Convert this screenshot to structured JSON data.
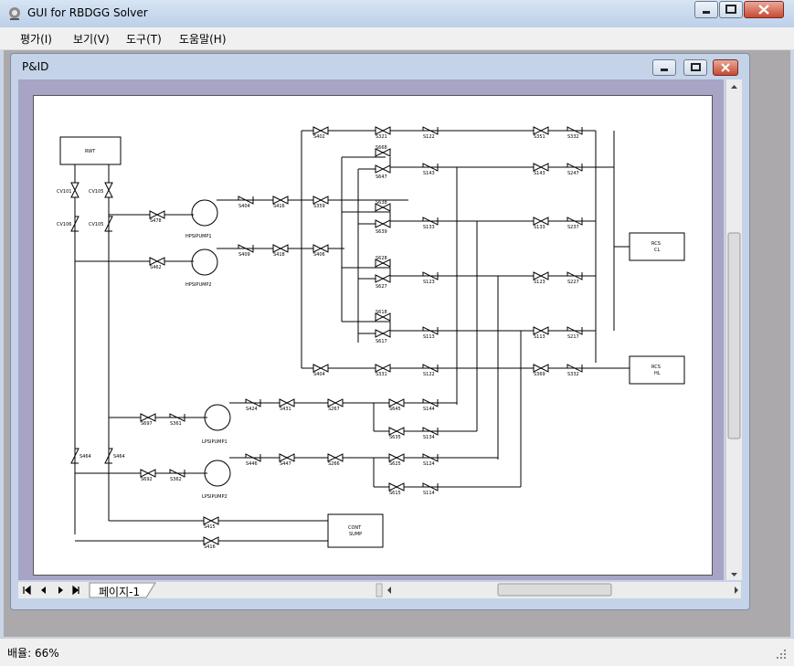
{
  "app": {
    "title": "GUI for RBDGG Solver"
  },
  "menu": {
    "items": [
      "평가(I)",
      "보기(V)",
      "도구(T)",
      "도움말(H)"
    ]
  },
  "child_window": {
    "title": "P&ID"
  },
  "tabs": {
    "page_tab": "페이지-1"
  },
  "status": {
    "zoom": "배율: 66%"
  },
  "diagram": {
    "boxes": {
      "rwt": "RWT",
      "rcs_cl": "RCS",
      "rcs_cl2": "CL",
      "rcs_hl": "RCS",
      "rcs_hl2": "HL",
      "sump": "CONT",
      "sump2": "SUMP"
    },
    "pumps": {
      "hp1": "HPSIPUMP1",
      "hp2": "HPSIPUMP2",
      "lp1": "LPSIPUMP1",
      "lp2": "LPSIPUMP2"
    },
    "left": {
      "v_a": "CV101",
      "v_b": "CV105",
      "s_a": "CV106",
      "s_b": "CV105",
      "s_c": "S464",
      "s_d": "S464",
      "s_e": "S478",
      "s_f": "S462"
    },
    "mid": {
      "s1": "S404",
      "s2": "S416",
      "s3": "S359",
      "s4": "S409",
      "s5": "S418",
      "s6": "S406"
    },
    "top": {
      "a": "S402",
      "b": "S321",
      "c": "S122",
      "d": "S351",
      "e": "S332"
    },
    "branch": {
      "r1": "S668",
      "r2": "S647",
      "r3": "S638",
      "r4": "S639",
      "r5": "S628",
      "r6": "S627",
      "r7": "S618",
      "r8": "S617"
    },
    "checks": {
      "c1": "S143",
      "c2": "S133",
      "c3": "S123",
      "c4": "S113",
      "d1": "S143",
      "d2": "S133",
      "d3": "S123",
      "d4": "S113",
      "e1": "S247",
      "e2": "S237",
      "e3": "S227",
      "e4": "S217"
    },
    "hl": {
      "a": "S404",
      "b": "S331",
      "c": "S122",
      "d": "S369",
      "e": "S332"
    },
    "lp": {
      "a": "S697",
      "b": "S361",
      "c": "S424",
      "d": "S431",
      "e": "S267",
      "f": "S692",
      "g": "S362",
      "h": "S446",
      "i": "S447",
      "j": "S266"
    },
    "lpb": {
      "a": "S645",
      "b": "S144",
      "c": "S635",
      "d": "S134",
      "e": "S625",
      "f": "S124",
      "g": "S615",
      "h": "S114"
    },
    "sumpv": {
      "a": "S415",
      "b": "S416"
    }
  }
}
